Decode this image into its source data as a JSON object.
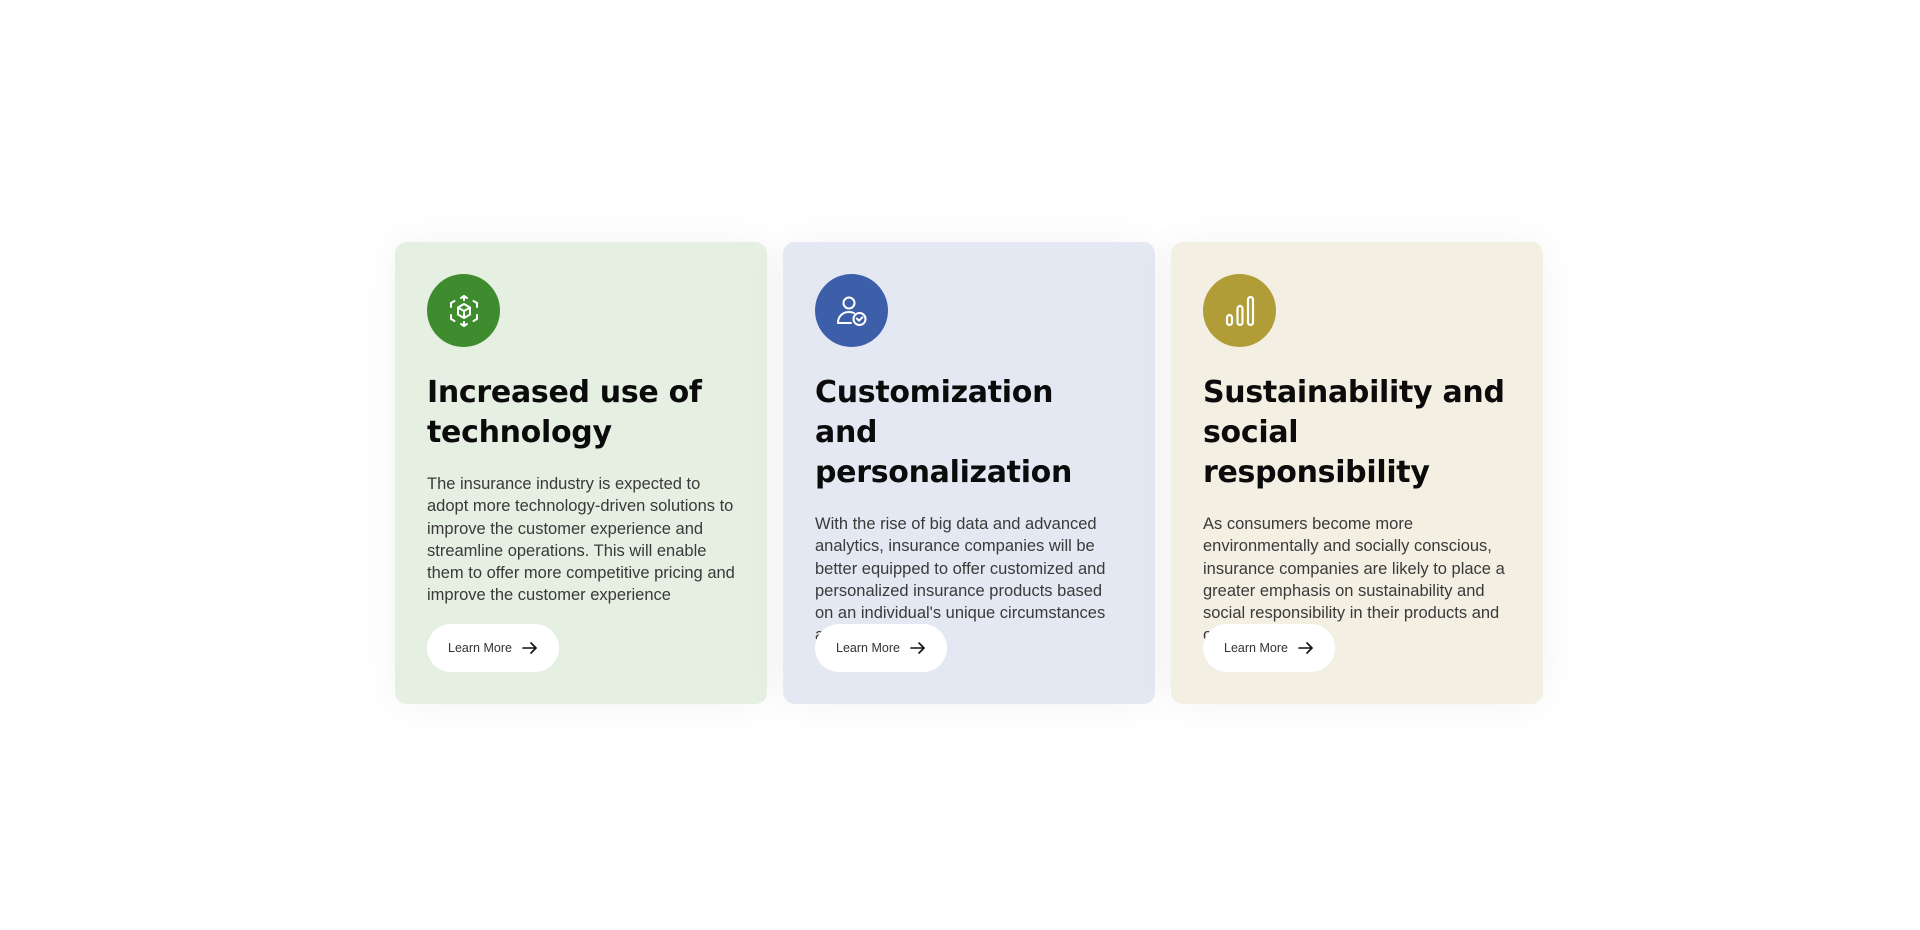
{
  "cards": [
    {
      "icon": "cube-scan-icon",
      "accent": "#3f8c2f",
      "background": "#e5efe2",
      "title": "Increased use of technology",
      "description": "The insurance industry is expected to adopt more technology-driven solutions to improve the customer experience and streamline operations. This will enable them to offer more competitive pricing and improve the customer experience",
      "button_label": "Learn More"
    },
    {
      "icon": "user-check-icon",
      "accent": "#3d5faa",
      "background": "#e4e8f3",
      "title": "Customization and personalization",
      "description": "With the rise of big data and advanced analytics, insurance companies will be better equipped to offer customized and personalized insurance products based on an individual's unique circumstances and needs",
      "button_label": "Learn More"
    },
    {
      "icon": "bar-chart-icon",
      "accent": "#b19d37",
      "background": "#f3efe2",
      "title": "Sustainability and social responsibility",
      "description": "As consumers become more environmentally and socially conscious, insurance companies are likely to place a greater emphasis on sustainability and social responsibility in their products and operations",
      "button_label": "Learn More"
    }
  ]
}
